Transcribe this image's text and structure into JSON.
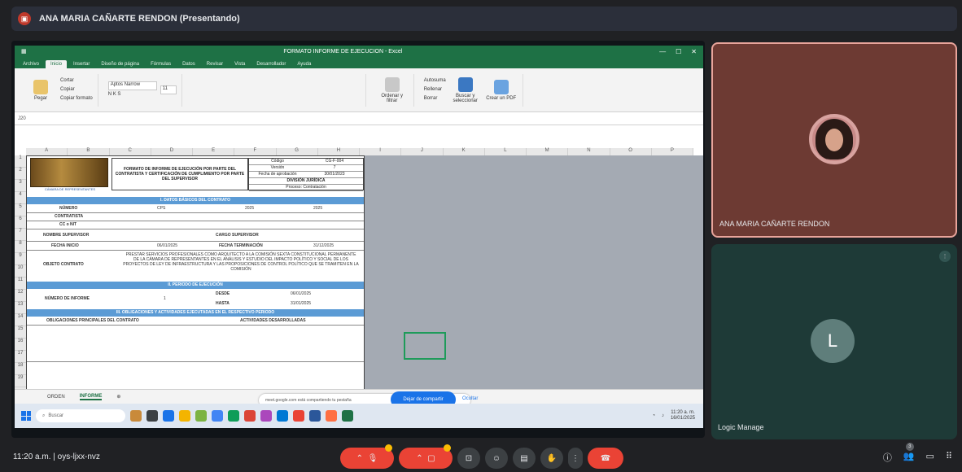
{
  "meet": {
    "presenter_banner": "ANA MARIA CAÑARTE RENDON (Presentando)",
    "time": "11:20 a.m.",
    "meeting_code": "oys-ljxx-nvz",
    "participant_count": "3",
    "share_notice": "meet.google.com está compartiendo tu pestaña",
    "stop_share_label": "Dejar de compartir",
    "hide_label": "Ocultar"
  },
  "participants": [
    {
      "name": "ANA MARIA CAÑARTE RENDON",
      "type": "video"
    },
    {
      "name": "Logic Manage",
      "initial": "L",
      "type": "avatar"
    }
  ],
  "excel": {
    "window_title": "FORMATO INFORME DE EJECUCION - Excel",
    "tabs": [
      "Archivo",
      "Inicio",
      "Insertar",
      "Diseño de página",
      "Fórmulas",
      "Datos",
      "Revisar",
      "Vista",
      "Desarrollador",
      "Ayuda"
    ],
    "ribbon": {
      "paste": "Pegar",
      "cut": "Cortar",
      "copy": "Copiar",
      "format_painter": "Copiar formato",
      "font": "Aptos Narrow",
      "font_size": "11",
      "autosum": "Autosuma",
      "fill": "Rellenar",
      "clear": "Borrar",
      "sort_filter": "Ordenar y filtrar",
      "find_select": "Buscar y seleccionar",
      "create_pdf": "Crear un PDF",
      "group_clipboard": "Portapapeles",
      "group_font": "Fuente",
      "group_alignment": "Alineación",
      "group_number": "Número",
      "group_styles": "Estilos",
      "group_cells": "Celdas",
      "group_editing": "Edición",
      "group_adobe": "Adobe Acrobat"
    },
    "namebox": "J20",
    "columns": [
      "A",
      "B",
      "C",
      "D",
      "E",
      "F",
      "G",
      "H",
      "I",
      "J",
      "K",
      "L",
      "M",
      "N",
      "O",
      "P"
    ],
    "rows": [
      "1",
      "2",
      "3",
      "4",
      "5",
      "6",
      "7",
      "8",
      "9",
      "10",
      "11",
      "12",
      "13",
      "14",
      "15",
      "16",
      "17",
      "18",
      "19"
    ],
    "form": {
      "logo_caption": "CÁMARA DE REPRESENTANTES",
      "title": "FORMATO DE INFORME DE EJECUCIÓN POR PARTE DEL CONTRATISTA Y CERTIFICACIÓN DE CUMPLIMIENTO POR PARTE DEL SUPERVISOR",
      "meta": [
        [
          "Código",
          "CG-F-004"
        ],
        [
          "Versión",
          "7"
        ],
        [
          "Fecha de aprobación",
          "30/01/2023"
        ],
        [
          "DIVISIÓN JURÍDICA",
          ""
        ],
        [
          "Proceso: Contratación",
          ""
        ]
      ],
      "section1": "I. DATOS BÁSICOS DEL CONTRATO",
      "numero_label": "NÚMERO",
      "numero_value": "CPS",
      "year1": "2025",
      "year2": "2025",
      "contratista_label": "CONTRATISTA",
      "cc_label": "CC o NIT",
      "supervisor_label": "NOMBRE SUPERVISOR",
      "cargo_label": "CARGO SUPERVISOR",
      "fecha_inicio_label": "FECHA INICIO",
      "fecha_inicio_value": "06/01/2025",
      "fecha_term_label": "FECHA TERMINACIÓN",
      "fecha_term_value": "31/12/2025",
      "objeto_label": "OBJETO CONTRATO",
      "objeto_text": "PRESTAR SERVICIOS PROFESIONALES COMO ARQUITECTO A LA COMISIÓN SEXTA CONSTITUCIONAL PERMANENTE DE LA CÁMARA DE REPRESENTANTES EN EL ANÁLISIS Y ESTUDIO DEL IMPACTO POLÍTICO Y SOCIAL DE LOS PROYECTOS DE LEY DE INFRAESTRUCTURA Y LAS PROPOSICIONES DE CONTROL POLÍTICO QUE SE TRAMITEN EN LA COMISIÓN",
      "section2": "II. PERIODO DE EJECUCIÓN",
      "informe_label": "NÚMERO DE INFORME",
      "informe_value": "1",
      "desde_label": "DESDE",
      "desde_value": "06/01/2025",
      "hasta_label": "HASTA",
      "hasta_value": "31/01/2025",
      "section3": "III. OBLIGACIONES Y ACTIVIDADES EJECUTADAS EN EL RESPECTIVO PERIODO",
      "col_obligaciones": "OBLIGACIONES PRINCIPALES DEL CONTRATO",
      "col_actividades": "ACTIVIDADES DESARROLLADAS"
    },
    "sheets": [
      "ORDEN",
      "INFORME"
    ],
    "taskbar_search": "Buscar",
    "taskbar_time": "11:20 a. m.",
    "taskbar_date": "16/01/2025"
  }
}
